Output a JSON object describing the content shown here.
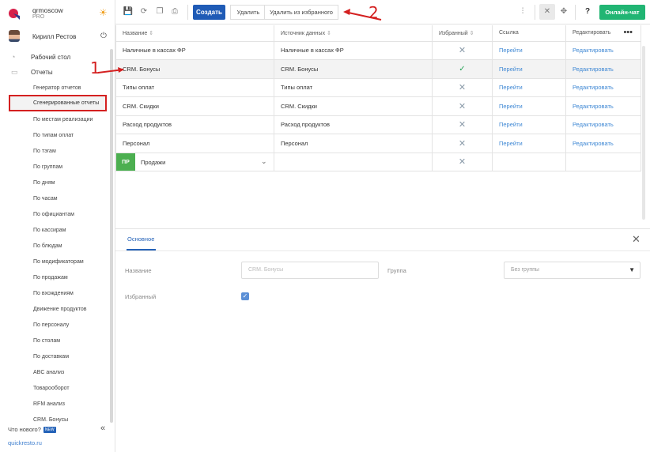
{
  "sidebar": {
    "brand_name": "qrmoscow",
    "brand_plan": "PRO",
    "user_name": "Кирилл Рестов",
    "nav": [
      {
        "label": "Рабочий стол",
        "icon": "dashboard-icon"
      },
      {
        "label": "Отчеты",
        "icon": "reports-icon"
      }
    ],
    "sub_items": [
      "Генератор отчетов",
      "Сгенерированные отчеты",
      "По местам реализации",
      "По типам оплат",
      "По тэгам",
      "По группам",
      "По дням",
      "По часам",
      "По официантам",
      "По кассирам",
      "По блюдам",
      "По модификаторам",
      "По продажам",
      "По вхождениям",
      "Движение продуктов",
      "По персоналу",
      "По столам",
      "По доставкам",
      "ABC анализ",
      "Товарооборот",
      "RFM анализ",
      "CRM. Бонусы"
    ],
    "active_sub": "Сгенерированные отчеты",
    "whats_new": "Что нового?",
    "new_badge": "NEW",
    "site": "quickresto.ru"
  },
  "toolbar": {
    "create_label": "Создать",
    "delete_label": "Удалить",
    "unfav_label": "Удалить из избранного",
    "chat_label": "Онлайн-чат"
  },
  "table": {
    "headers": [
      "Название",
      "Источник данных",
      "Избранный",
      "Ссылка",
      "Редактировать"
    ],
    "rows": [
      {
        "name": "Наличные в кассах ФР",
        "source": "Наличные в кассах ФР",
        "fav": false,
        "link": "Перейти",
        "edit": "Редактировать"
      },
      {
        "name": "CRM. Бонусы",
        "source": "CRM. Бонусы",
        "fav": true,
        "link": "Перейти",
        "edit": "Редактировать"
      },
      {
        "name": "Типы оплат",
        "source": "Типы оплат",
        "fav": false,
        "link": "Перейти",
        "edit": "Редактировать"
      },
      {
        "name": "CRM. Скидки",
        "source": "CRM. Скидки",
        "fav": false,
        "link": "Перейти",
        "edit": "Редактировать"
      },
      {
        "name": "Расход продуктов",
        "source": "Расход продуктов",
        "fav": false,
        "link": "Перейти",
        "edit": "Редактировать"
      },
      {
        "name": "Персонал",
        "source": "Персонал",
        "fav": false,
        "link": "Перейти",
        "edit": "Редактировать"
      }
    ],
    "group_row": {
      "badge": "ПР",
      "label": "Продажи"
    },
    "sort_glyph": "⇕",
    "more_glyph": "•••"
  },
  "panel": {
    "tab_label": "Основное",
    "name_label": "Название",
    "name_value": "CRM. Бонусы",
    "group_label": "Группа",
    "group_value": "Без группы",
    "fav_label": "Избранный"
  },
  "annotations": {
    "one": "1",
    "two": "2"
  },
  "colors": {
    "primary": "#1f5bb6",
    "chat": "#21b573",
    "highlight": "#d42020",
    "link": "#3f88d4",
    "group_badge": "#4caf50"
  }
}
